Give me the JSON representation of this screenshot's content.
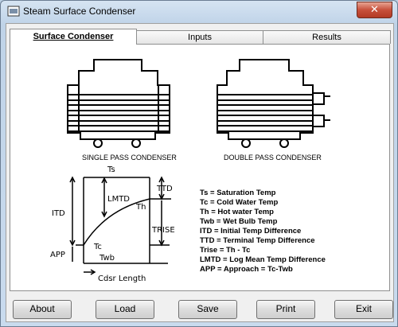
{
  "window": {
    "title": "Steam Surface Condenser",
    "close_glyph": "✕"
  },
  "tabs": [
    {
      "label": "Surface Condenser",
      "active": true
    },
    {
      "label": "Inputs",
      "active": false
    },
    {
      "label": "Results",
      "active": false
    }
  ],
  "diagram": {
    "single_caption": "SINGLE PASS CONDENSER",
    "double_caption": "DOUBLE PASS CONDENSER",
    "graph": {
      "ts": "Ts",
      "lmtd": "LMTD",
      "th": "Th",
      "tc": "Tc",
      "twb": "Twb",
      "itd": "ITD",
      "app": "APP",
      "ttd": "TTD",
      "trise": "TRISE",
      "x_axis": "Cdsr Length"
    },
    "legend": [
      "Ts = Saturation Temp",
      "Tc = Cold Water Temp",
      "Th = Hot water Temp",
      "Twb = Wet Bulb Temp",
      "ITD = Initial Temp Difference",
      "TTD = Terminal Temp Difference",
      "Trise = Th - Tc",
      "LMTD = Log Mean Temp Difference",
      "APP = Approach = Tc-Twb"
    ]
  },
  "buttons": {
    "about": "About",
    "load": "Load",
    "save": "Save",
    "print": "Print",
    "exit": "Exit"
  }
}
